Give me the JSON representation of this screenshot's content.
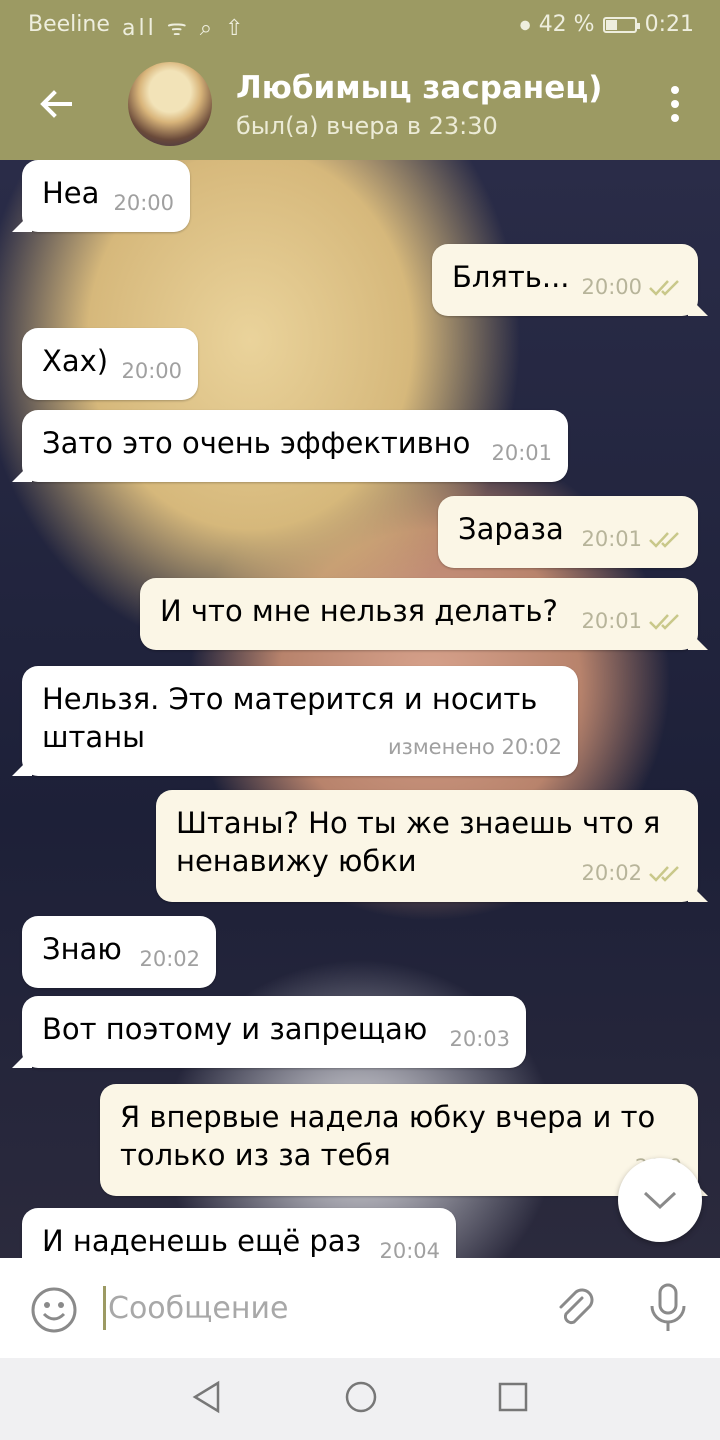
{
  "status_bar": {
    "carrier": "Beeline",
    "signal_icons": "all ᯤ ⌕ ⇧",
    "battery_text": "42 %",
    "battery_level": 0.42,
    "time": "0:21"
  },
  "header": {
    "back_icon": "arrow-left-icon",
    "title": "Любимыц засранец)",
    "subtitle": "был(а) вчера в 23:30",
    "menu_icon": "more-vertical-icon"
  },
  "colors": {
    "accent": "#9c9a63",
    "incoming_bubble": "#ffffff",
    "outgoing_bubble": "#fbf6e6",
    "check": "#c9c88a"
  },
  "messages": [
    {
      "dir": "in",
      "text": "Неа",
      "meta": "20:00"
    },
    {
      "dir": "out",
      "text": "Блять...",
      "meta": "20:00"
    },
    {
      "dir": "in",
      "text": "Хах)",
      "meta": "20:00"
    },
    {
      "dir": "in",
      "text": "Зато это очень эффективно",
      "meta": "20:01"
    },
    {
      "dir": "out",
      "text": "Зараза",
      "meta": "20:01"
    },
    {
      "dir": "out",
      "text": "И что мне нельзя делать?",
      "meta": "20:01"
    },
    {
      "dir": "in",
      "text": "Нельзя. Это матерится и носить штаны",
      "meta": "изменено 20:02"
    },
    {
      "dir": "out",
      "text": "Штаны? Но ты же знаешь что я ненавижу юбки",
      "meta": "20:02"
    },
    {
      "dir": "in",
      "text": "Знаю",
      "meta": "20:02"
    },
    {
      "dir": "in",
      "text": "Вот поэтому и запрещаю",
      "meta": "20:03"
    },
    {
      "dir": "out",
      "text": "Я впервые надела юбку вчера и то только из за тебя",
      "meta": "20:0"
    },
    {
      "dir": "in",
      "text": "И наденешь ещё раз",
      "meta": "20:04"
    }
  ],
  "input": {
    "placeholder": "Сообщение",
    "value": ""
  }
}
